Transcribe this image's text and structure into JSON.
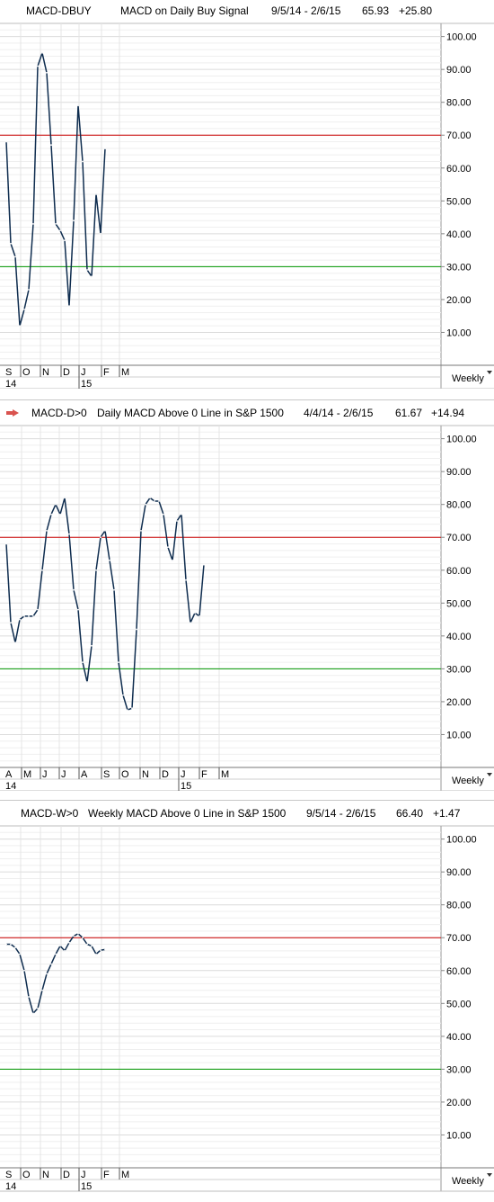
{
  "chart_data": [
    {
      "type": "line",
      "symbol": "MACD-DBUY",
      "title": "MACD on Daily Buy Signal",
      "date_range": "9/5/14 - 2/6/15",
      "last_value": "65.93",
      "change": "+25.80",
      "ylim": [
        0,
        104
      ],
      "y_ticks": [
        "100.00",
        "90.00",
        "80.00",
        "70.00",
        "60.00",
        "50.00",
        "40.00",
        "30.00",
        "20.00",
        "10.00"
      ],
      "y_tick_values": [
        100,
        90,
        80,
        70,
        60,
        50,
        40,
        30,
        20,
        10
      ],
      "reference_lines": [
        {
          "value": 70,
          "color": "#cc0000"
        },
        {
          "value": 30,
          "color": "#009900"
        }
      ],
      "x_months": [
        "S",
        "O",
        "N",
        "D",
        "J",
        "F",
        "M"
      ],
      "x_years": [
        {
          "label": "14",
          "month_index": 0
        },
        {
          "label": "15",
          "month_index": 4
        }
      ],
      "frequency": "Weekly",
      "series_color": "#0f2d4f",
      "x": [
        "9/5/14",
        "9/12/14",
        "9/19/14",
        "9/26/14",
        "10/3/14",
        "10/10/14",
        "10/17/14",
        "10/24/14",
        "10/31/14",
        "11/7/14",
        "11/14/14",
        "11/21/14",
        "11/28/14",
        "12/5/14",
        "12/12/14",
        "12/19/14",
        "12/26/14",
        "1/2/15",
        "1/9/15",
        "1/16/15",
        "1/23/15",
        "1/30/15",
        "2/6/15"
      ],
      "values": [
        68,
        37,
        33,
        12,
        17,
        23,
        43,
        91,
        95,
        89,
        67,
        43,
        41,
        38,
        18,
        44,
        79,
        62,
        29,
        27,
        52,
        40,
        65.93
      ]
    },
    {
      "type": "line",
      "symbol": "MACD-D>0",
      "title": "Daily MACD Above 0 Line in S&P 1500",
      "date_range": "4/4/14 - 2/6/15",
      "last_value": "61.67",
      "change": "+14.94",
      "ylim": [
        0,
        104
      ],
      "y_ticks": [
        "100.00",
        "90.00",
        "80.00",
        "70.00",
        "60.00",
        "50.00",
        "40.00",
        "30.00",
        "20.00",
        "10.00"
      ],
      "y_tick_values": [
        100,
        90,
        80,
        70,
        60,
        50,
        40,
        30,
        20,
        10
      ],
      "reference_lines": [
        {
          "value": 70,
          "color": "#cc0000"
        },
        {
          "value": 30,
          "color": "#009900"
        }
      ],
      "x_months": [
        "A",
        "M",
        "J",
        "J",
        "A",
        "S",
        "O",
        "N",
        "D",
        "J",
        "F",
        "M"
      ],
      "x_years": [
        {
          "label": "14",
          "month_index": 0
        },
        {
          "label": "15",
          "month_index": 9
        }
      ],
      "frequency": "Weekly",
      "series_color": "#0f2d4f",
      "x": [
        "4/4/14",
        "4/11/14",
        "4/18/14",
        "4/25/14",
        "5/2/14",
        "5/9/14",
        "5/16/14",
        "5/23/14",
        "5/30/14",
        "6/6/14",
        "6/13/14",
        "6/20/14",
        "6/27/14",
        "7/3/14",
        "7/11/14",
        "7/18/14",
        "7/25/14",
        "8/1/14",
        "8/8/14",
        "8/15/14",
        "8/22/14",
        "8/29/14",
        "9/5/14",
        "9/12/14",
        "9/19/14",
        "9/26/14",
        "10/3/14",
        "10/10/14",
        "10/17/14",
        "10/24/14",
        "10/31/14",
        "11/7/14",
        "11/14/14",
        "11/21/14",
        "11/28/14",
        "12/5/14",
        "12/12/14",
        "12/19/14",
        "12/26/14",
        "1/2/15",
        "1/9/15",
        "1/16/15",
        "1/23/15",
        "1/30/15",
        "2/6/15"
      ],
      "values": [
        68,
        44,
        38,
        45,
        46,
        46,
        46,
        48,
        60,
        72,
        77,
        80,
        77,
        82,
        71,
        54,
        48,
        32,
        26,
        37,
        60,
        70,
        72,
        63,
        54,
        32,
        22,
        17.5,
        18,
        42,
        72,
        80,
        82,
        81,
        81,
        77,
        67,
        63,
        75,
        77,
        57,
        44,
        47,
        46,
        61.67
      ]
    },
    {
      "type": "line",
      "symbol": "MACD-W>0",
      "title": "Weekly MACD Above 0 Line in S&P 1500",
      "date_range": "9/5/14 - 2/6/15",
      "last_value": "66.40",
      "change": "+1.47",
      "ylim": [
        0,
        104
      ],
      "y_ticks": [
        "100.00",
        "90.00",
        "80.00",
        "70.00",
        "60.00",
        "50.00",
        "40.00",
        "30.00",
        "20.00",
        "10.00"
      ],
      "y_tick_values": [
        100,
        90,
        80,
        70,
        60,
        50,
        40,
        30,
        20,
        10
      ],
      "reference_lines": [
        {
          "value": 70,
          "color": "#cc0000"
        },
        {
          "value": 30,
          "color": "#009900"
        }
      ],
      "x_months": [
        "S",
        "O",
        "N",
        "D",
        "J",
        "F",
        "M"
      ],
      "x_years": [
        {
          "label": "14",
          "month_index": 0
        },
        {
          "label": "15",
          "month_index": 4
        }
      ],
      "frequency": "Weekly",
      "series_color": "#0f2d4f",
      "x": [
        "9/5/14",
        "9/12/14",
        "9/19/14",
        "9/26/14",
        "10/3/14",
        "10/10/14",
        "10/17/14",
        "10/24/14",
        "10/31/14",
        "11/7/14",
        "11/14/14",
        "11/21/14",
        "11/28/14",
        "12/5/14",
        "12/12/14",
        "12/19/14",
        "12/26/14",
        "1/2/15",
        "1/9/15",
        "1/16/15",
        "1/23/15",
        "1/30/15",
        "2/6/15"
      ],
      "values": [
        68,
        68,
        67,
        65,
        60,
        52,
        47,
        48.5,
        54,
        59,
        62,
        65,
        67.5,
        66,
        68.5,
        70.5,
        71.2,
        70,
        68,
        67.5,
        65,
        66.2,
        66.4
      ]
    }
  ]
}
